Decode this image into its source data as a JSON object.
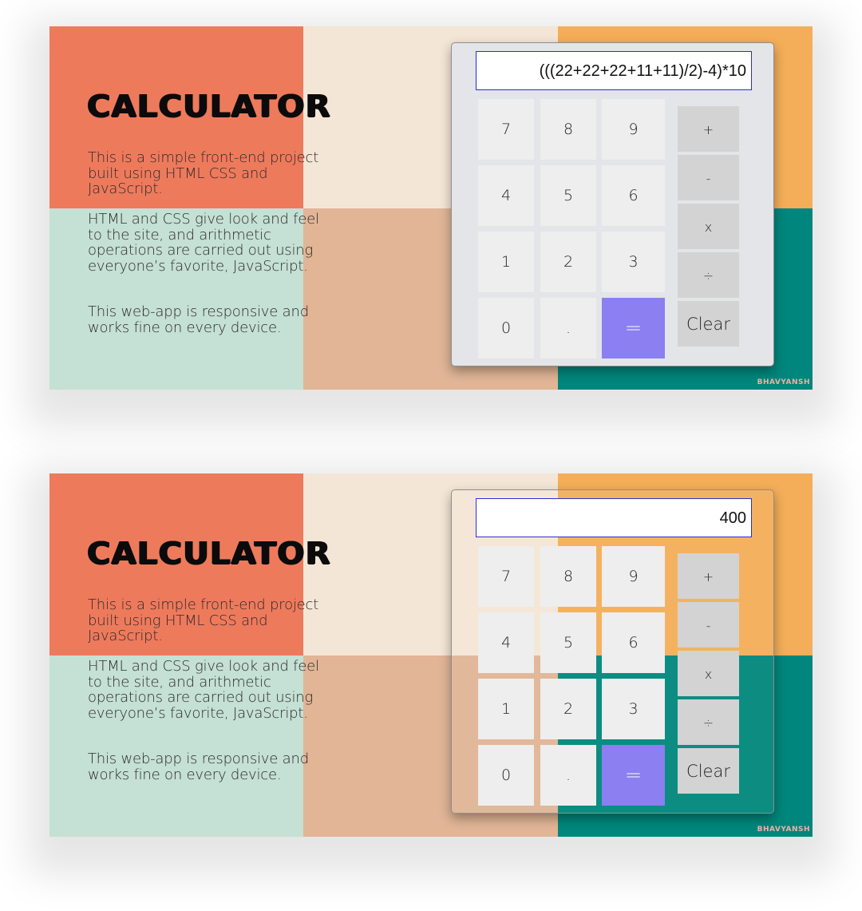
{
  "colors": {
    "coral": "#ee7a5c",
    "cream": "#f4e6d6",
    "orange": "#f4ae59",
    "mint": "#c5e0d4",
    "tan": "#e1b596",
    "teal": "#00867c",
    "equals": "#8b7ff2",
    "display_border": "#2d2dd0"
  },
  "page": {
    "title": "CALCULATOR",
    "paragraph1": "This is a simple front-end project built using HTML CSS and JavaScript.",
    "paragraph2": "HTML and CSS give look and feel to the site, and arithmetic operations are carried out using everyone’s favorite, JavaScript.",
    "paragraph3": "This web-app is responsive and works fine on every device.",
    "watermark": "BHAVYANSH"
  },
  "calculator": {
    "keys": {
      "k7": "7",
      "k8": "8",
      "k9": "9",
      "k4": "4",
      "k5": "5",
      "k6": "6",
      "k1": "1",
      "k2": "2",
      "k3": "3",
      "k0": "0",
      "dot": ".",
      "equals": "="
    },
    "ops": {
      "plus": "+",
      "minus": "-",
      "multiply": "x",
      "divide": "÷",
      "clear": "Clear"
    }
  },
  "screens": [
    {
      "display": "(((22+22+22+11+11)/2)-4)*10"
    },
    {
      "display": "400"
    }
  ]
}
